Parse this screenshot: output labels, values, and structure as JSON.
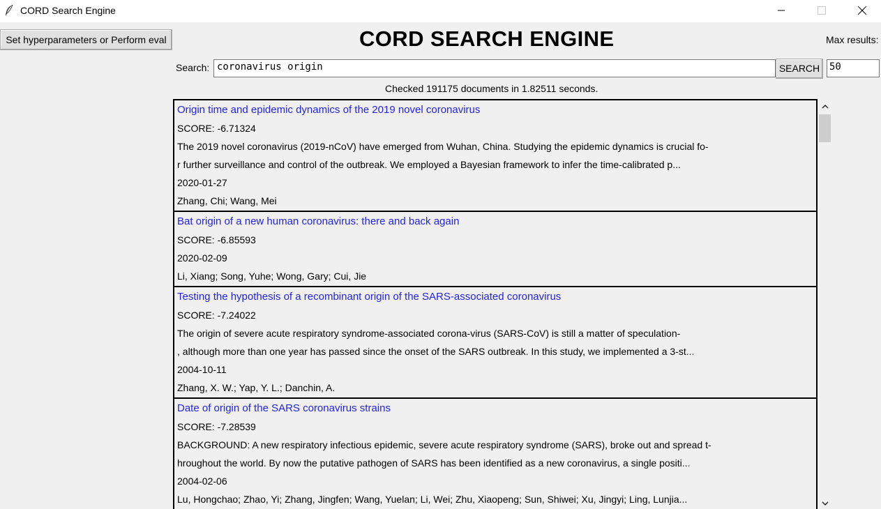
{
  "window": {
    "title": "CORD Search Engine",
    "app_icon": "feather-icon",
    "controls": {
      "minimize_icon": "minimize-icon",
      "maximize_icon": "maximize-icon",
      "close_icon": "close-icon"
    }
  },
  "toolbar": {
    "hyper_button_label": "Set hyperparameters or Perform eval",
    "heading": "CORD SEARCH ENGINE",
    "max_results_label": "Max results:",
    "max_results_value": "50"
  },
  "search": {
    "label": "Search:",
    "query": "coronavirus origin",
    "button_label": "SEARCH",
    "status": "Checked 191175 documents in 1.82511 seconds."
  },
  "results": [
    {
      "title": "Origin time and epidemic dynamics of the 2019 novel coronavirus",
      "score": "SCORE: -6.71324",
      "abstract": [
        "The 2019 novel coronavirus (2019-nCoV) have emerged from Wuhan, China. Studying the epidemic dynamics is crucial fo-",
        "r further surveillance and control of the outbreak. We employed a Bayesian framework to infer the time-calibrated p..."
      ],
      "date": "2020-01-27",
      "authors": "Zhang, Chi; Wang, Mei"
    },
    {
      "title": "Bat origin of a new human coronavirus: there and back again",
      "score": "SCORE: -6.85593",
      "abstract": [],
      "date": "2020-02-09",
      "authors": "Li, Xiang; Song, Yuhe; Wong, Gary; Cui, Jie"
    },
    {
      "title": "Testing the hypothesis of a recombinant origin of the SARS-associated coronavirus",
      "score": "SCORE: -7.24022",
      "abstract": [
        "The origin of severe acute respiratory syndrome-associated corona-virus (SARS-CoV) is still a matter of speculation-",
        ", although more than one year has passed since the onset of the SARS outbreak. In this study, we implemented a 3-st..."
      ],
      "date": "2004-10-11",
      "authors": "Zhang, X. W.; Yap, Y. L.; Danchin, A."
    },
    {
      "title": "Date of origin of the SARS coronavirus strains",
      "score": "SCORE: -7.28539",
      "abstract": [
        "BACKGROUND: A new respiratory infectious epidemic, severe acute respiratory syndrome (SARS), broke out and spread t-",
        "hroughout the world. By now the putative pathogen of SARS has been identified as a new coronavirus, a single positi..."
      ],
      "date": "2004-02-06",
      "authors": "Lu, Hongchao; Zhao, Yi; Zhang, Jingfen; Wang, Yuelan; Li, Wei; Zhu, Xiaopeng; Sun, Shiwei; Xu, Jingyi; Ling, Lunjia..."
    }
  ],
  "scrollbar": {
    "up_icon": "chevron-up-icon",
    "down_icon": "chevron-down-icon",
    "position": 0.0
  }
}
